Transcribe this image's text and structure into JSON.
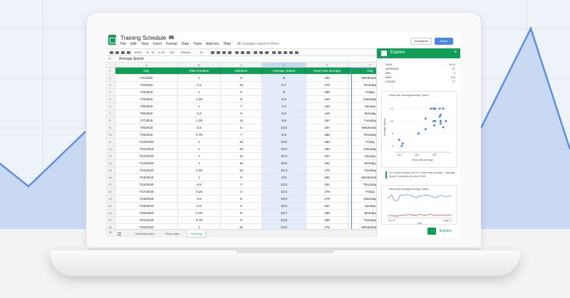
{
  "app": {
    "title": "Training Schedule",
    "menu": [
      "File",
      "Edit",
      "View",
      "Insert",
      "Format",
      "Data",
      "Tools",
      "Add-ons",
      "Help"
    ],
    "save_status": "All changes saved in Drive",
    "comments_label": "Comments",
    "share_label": "Share"
  },
  "toolbar": {
    "zoom": "100%",
    "currency": "$",
    "percent": "%",
    "decimals": ".0 .00",
    "number_format": "123",
    "font": "Roboto",
    "font_size": "10"
  },
  "formula_bar": {
    "fx": "fx",
    "value": "Average Speed"
  },
  "columns": [
    "A",
    "B",
    "C",
    "D",
    "E",
    "F"
  ],
  "header_row": [
    "Day",
    "Ride Duration",
    "Distance",
    "Average Speed",
    "Heart rate average",
    "Day"
  ],
  "rows": [
    [
      "7/1/2015",
      "1",
      "8",
      "8",
      "162",
      "Wednesday"
    ],
    [
      "7/2/2015",
      "1.5",
      "13",
      "8.7",
      "170",
      "Thursday"
    ],
    [
      "7/3/2015",
      "1",
      "9",
      "9",
      "190",
      "Friday"
    ],
    [
      "7/4/2015",
      "1.25",
      "8",
      "6.4",
      "144",
      "Saturday"
    ],
    [
      "7/5/2015",
      "1",
      "7",
      "7.0",
      "140",
      "Sunday"
    ],
    [
      "7/6/2015",
      "1.5",
      "9",
      "6.0",
      "143",
      "Monday"
    ],
    [
      "7/7/2015",
      "1.25",
      "12",
      "9.6",
      "187",
      "Tuesday"
    ],
    [
      "7/8/2015",
      "0.5",
      "5",
      "10.0",
      "187",
      "Wednesday"
    ],
    [
      "7/9/2015",
      "0.75",
      "7",
      "9.3",
      "180",
      "Thursday"
    ],
    [
      "7/10/2015",
      "1",
      "10",
      "10.0",
      "193",
      "Friday"
    ],
    [
      "7/11/2015",
      "1",
      "12",
      "12.0",
      "190",
      "Saturday"
    ],
    [
      "7/12/2015",
      "1",
      "11",
      "11.0",
      "187",
      "Sunday"
    ],
    [
      "7/13/2015",
      "1",
      "10",
      "10.0",
      "181",
      "Monday"
    ],
    [
      "7/14/2015",
      "1.25",
      "13",
      "10.4",
      "170",
      "Tuesday"
    ],
    [
      "7/15/2015",
      "1",
      "8",
      "8.0",
      "162",
      "Wednesday"
    ],
    [
      "7/16/2015",
      "0.5",
      "7",
      "12.0",
      "181",
      "Thursday"
    ],
    [
      "7/17/2015",
      "0.25",
      "3",
      "12.0",
      "179",
      "Friday"
    ],
    [
      "7/18/2015",
      "0.5",
      "5",
      "10.0",
      "179",
      "Saturday"
    ],
    [
      "7/19/2015",
      "0.5",
      "5",
      "10.0",
      "187",
      "Sunday"
    ],
    [
      "7/20/2015",
      "0.75",
      "8",
      "10.7",
      "186",
      "Monday"
    ],
    [
      "7/21/2015",
      "0.75",
      "9",
      "12.0",
      "186",
      "Tuesday"
    ],
    [
      "7/22/2015",
      "1",
      "12",
      "12.0",
      "176",
      "Wednesday"
    ]
  ],
  "sheet_tabs": [
    "Individual stats",
    "Team stats",
    "June/July"
  ],
  "active_tab": "June/July",
  "explore": {
    "title": "Explore",
    "stats": [
      {
        "label": "SUM",
        "value": "5400"
      },
      {
        "label": "AVERAGE",
        "value": "87"
      },
      {
        "label": "MIN",
        "value": "6"
      },
      {
        "label": "MAX",
        "value": "190"
      },
      {
        "label": "COUNT",
        "value": "72"
      }
    ],
    "scatter_title": "Heart rate average/Average Speed",
    "scatter_ylabel": "Average Speed",
    "scatter_xlabel": "Heart rate average",
    "scatter_yticks": [
      "12",
      "10",
      "8",
      "6"
    ],
    "scatter_xticks": [
      "140",
      "160",
      "180"
    ],
    "insight": "For every increase of 10 in \"Heart rate average\", \"Average Speed\" increases by about 0.56.",
    "line_title": "Heart rate average/Average Speed",
    "line_xticks": [
      "Jul 15",
      "Aug 14"
    ],
    "line_xlabel": "Day",
    "button_label": "Explore"
  },
  "colors": {
    "sheets_green": "#0f9d58",
    "selection_blue": "#4a86e8",
    "heart_rate_line": "#4a86e8",
    "speed_line": "#db4437"
  },
  "chart_data": [
    {
      "type": "scatter",
      "title": "Heart rate average/Average Speed",
      "xlabel": "Heart rate average",
      "ylabel": "Average Speed",
      "points": [
        [
          162,
          8
        ],
        [
          170,
          8.7
        ],
        [
          190,
          9
        ],
        [
          144,
          6.4
        ],
        [
          140,
          7
        ],
        [
          143,
          6
        ],
        [
          187,
          9.6
        ],
        [
          187,
          10
        ],
        [
          180,
          9.3
        ],
        [
          193,
          10
        ],
        [
          190,
          12
        ],
        [
          187,
          11
        ],
        [
          181,
          10
        ],
        [
          170,
          10.4
        ],
        [
          162,
          8
        ],
        [
          181,
          12
        ],
        [
          179,
          12
        ],
        [
          179,
          10
        ],
        [
          187,
          10
        ],
        [
          186,
          10.7
        ],
        [
          186,
          12
        ],
        [
          176,
          12
        ]
      ],
      "xlim": [
        135,
        198
      ],
      "ylim": [
        5,
        13
      ]
    },
    {
      "type": "line",
      "title": "Heart rate average/Average Speed",
      "xlabel": "Day",
      "series": [
        {
          "name": "",
          "values": [
            162,
            170,
            190,
            144,
            140,
            143,
            187,
            187,
            180,
            193,
            190,
            187,
            181,
            170,
            162,
            181,
            179,
            179,
            187,
            186,
            186,
            176,
            170,
            168,
            172,
            180,
            184,
            178,
            174,
            176,
            180,
            182
          ]
        },
        {
          "name": "",
          "values": [
            8,
            8.7,
            9,
            6.4,
            7,
            6,
            9.6,
            10,
            9.3,
            10,
            12,
            11,
            10,
            10.4,
            8,
            12,
            12,
            10,
            10,
            10.7,
            12,
            12,
            10,
            10,
            11,
            10,
            9,
            10,
            11,
            10,
            10,
            11
          ]
        }
      ]
    }
  ]
}
